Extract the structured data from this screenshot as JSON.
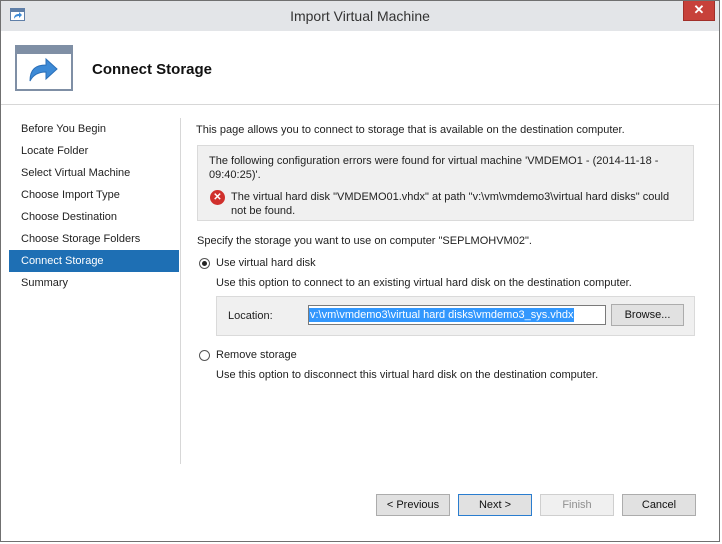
{
  "window": {
    "title": "Import Virtual Machine",
    "close_glyph": "✕",
    "app_icon": "import-vm-icon"
  },
  "header": {
    "title": "Connect Storage",
    "icon": "import-arrow-icon"
  },
  "nav": {
    "items": [
      {
        "label": "Before You Begin"
      },
      {
        "label": "Locate Folder"
      },
      {
        "label": "Select Virtual Machine"
      },
      {
        "label": "Choose Import Type"
      },
      {
        "label": "Choose Destination"
      },
      {
        "label": "Choose Storage Folders"
      },
      {
        "label": "Connect Storage"
      },
      {
        "label": "Summary"
      }
    ],
    "selected_index": 6
  },
  "content": {
    "intro": "This page allows you to connect to storage that is available on the destination computer.",
    "error_header": "The following configuration errors were found for virtual machine 'VMDEMO1 - (2014-11-18 - 09:40:25)'.",
    "error_glyph": "✕",
    "error_message": "The virtual hard disk \"VMDEMO01.vhdx\" at path \"v:\\vm\\vmdemo3\\virtual hard disks\" could not be found.",
    "specify": "Specify the storage you want to use on computer \"SEPLMOHVM02\".",
    "option_use": {
      "label": "Use virtual hard disk",
      "desc": "Use this option to connect to an existing virtual hard disk on the destination computer.",
      "selected": true
    },
    "location": {
      "label": "Location:",
      "value": "v:\\vm\\vmdemo3\\virtual hard disks\\vmdemo3_sys.vhdx",
      "browse": "Browse..."
    },
    "option_remove": {
      "label": "Remove storage",
      "desc": "Use this option to disconnect this virtual hard disk on the destination computer.",
      "selected": false
    }
  },
  "buttons": {
    "previous": "< Previous",
    "next": "Next >",
    "finish": "Finish",
    "cancel": "Cancel"
  },
  "colors": {
    "selection": "#1e6fb4",
    "error": "#d0302c",
    "close": "#c7413a"
  }
}
